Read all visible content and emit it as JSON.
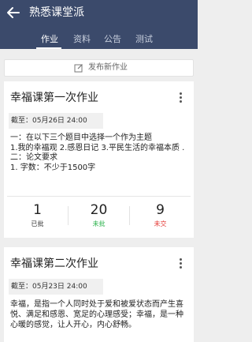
{
  "header": {
    "title": "熟悉课堂派",
    "tabs": [
      "作业",
      "资料",
      "公告",
      "测试"
    ]
  },
  "publish_button": {
    "label": "发布新作业"
  },
  "cards": [
    {
      "title": "幸福课第一次作业",
      "deadline": "截至：05月26日  24:00",
      "lines": [
        "一：在以下三个题目中选择一个作为主题",
        "    1.我的幸福观 2.感恩日记 3.平民生活的幸福本质 .",
        "二：论文要求",
        "    1. 字数：不少于1500字"
      ],
      "stats": [
        {
          "value": "1",
          "label": "已批",
          "color": "#333333"
        },
        {
          "value": "20",
          "label": "未批",
          "color": "#2bb24c"
        },
        {
          "value": "9",
          "label": "未交",
          "color": "#e53935"
        }
      ]
    },
    {
      "title": "幸福课第二次作业",
      "deadline": "截至：05月23日  24:00",
      "lines": [
        "        幸福，是指一个人同时处于爱和被爱状态而产生喜悦、满足和感恩、宽足的心理感受；幸福，是一种心暖的感觉，让人开心，内心舒畅。"
      ]
    }
  ]
}
